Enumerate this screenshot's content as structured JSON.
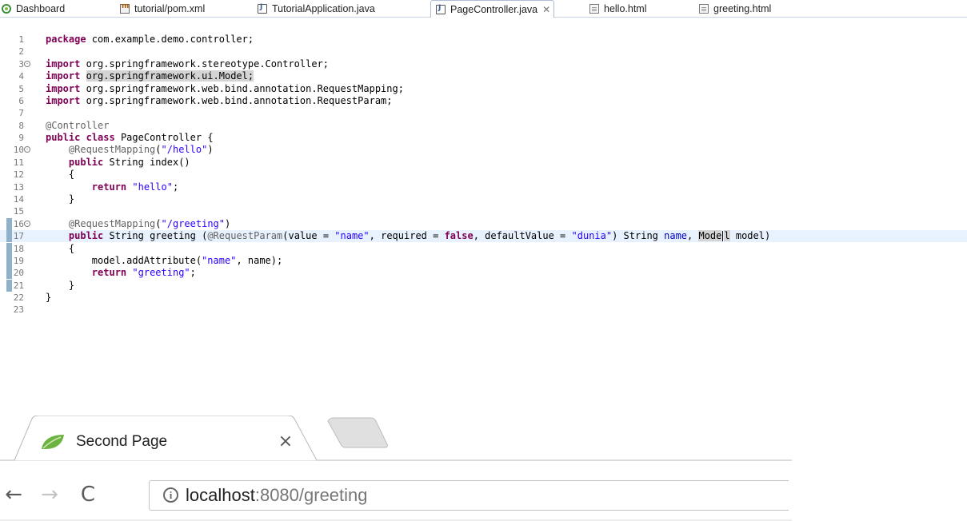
{
  "editor_tabs": [
    {
      "label": "Dashboard",
      "icon": "dashboard-icon"
    },
    {
      "label": "tutorial/pom.xml",
      "icon": "maven-file-icon"
    },
    {
      "label": "TutorialApplication.java",
      "icon": "java-file-icon"
    },
    {
      "label": "PageController.java",
      "icon": "java-file-icon",
      "active": true,
      "close": "✕"
    },
    {
      "label": "hello.html",
      "icon": "html-file-icon"
    },
    {
      "label": "greeting.html",
      "icon": "html-file-icon"
    }
  ],
  "code": {
    "lines": [
      {
        "n": "1"
      },
      {
        "n": "2"
      },
      {
        "n": "3"
      },
      {
        "n": "4"
      },
      {
        "n": "5"
      },
      {
        "n": "6"
      },
      {
        "n": "7"
      },
      {
        "n": "8"
      },
      {
        "n": "9"
      },
      {
        "n": "10"
      },
      {
        "n": "11"
      },
      {
        "n": "12"
      },
      {
        "n": "13"
      },
      {
        "n": "14"
      },
      {
        "n": "15"
      },
      {
        "n": "16"
      },
      {
        "n": "17"
      },
      {
        "n": "18"
      },
      {
        "n": "19"
      },
      {
        "n": "20"
      },
      {
        "n": "21"
      },
      {
        "n": "22"
      },
      {
        "n": "23"
      }
    ],
    "kw_package": "package",
    "pkg_name": " com.example.demo.controller;",
    "kw_import": "import",
    "import3": " org.springframework.stereotype.Controller;",
    "import4": "org.springframework.ui.Model;",
    "import5": " org.springframework.web.bind.annotation.RequestMapping;",
    "import6": " org.springframework.web.bind.annotation.RequestParam;",
    "ann_controller": "@Controller",
    "kw_public": "public",
    "kw_class": "class",
    "class_name": " PageController {",
    "ann_reqmap": "@RequestMapping",
    "path_hello": "\"/hello\"",
    "str_type": " String",
    "index_sig": " index()",
    "open_brace": "{",
    "close_brace": "}",
    "kw_return": "return",
    "str_hello": "\"hello\"",
    "path_greeting": "\"/greeting\"",
    "greeting_sig": " greeting (",
    "ann_reqparam": "@RequestParam",
    "value_eq": "(value = ",
    "str_name": "\"name\"",
    "required_eq": ", required = ",
    "kw_false": "false",
    "default_eq": ", defaultValue = ",
    "str_dunia": "\"dunia\"",
    "param_name_type": ") String ",
    "param_name": "name",
    "param_sep": ", ",
    "model_a": "Mode",
    "model_b": "l",
    "param_model": " model)",
    "add_attr_call": "model.addAttribute(",
    "add_attr_rest": ", name);",
    "str_greeting": "\"greeting\""
  },
  "browser": {
    "tab_title": "Second Page",
    "tab_close": "×",
    "back": "←",
    "forward": "→",
    "reload": "C",
    "info_icon": "i",
    "url_host": "localhost",
    "url_rest": ":8080/greeting"
  },
  "colors": {
    "keyword": "#7f0055",
    "string": "#2a00ff",
    "annotation": "#646464",
    "current_line": "#e8f2fe",
    "spring_leaf": "#6db33f"
  }
}
